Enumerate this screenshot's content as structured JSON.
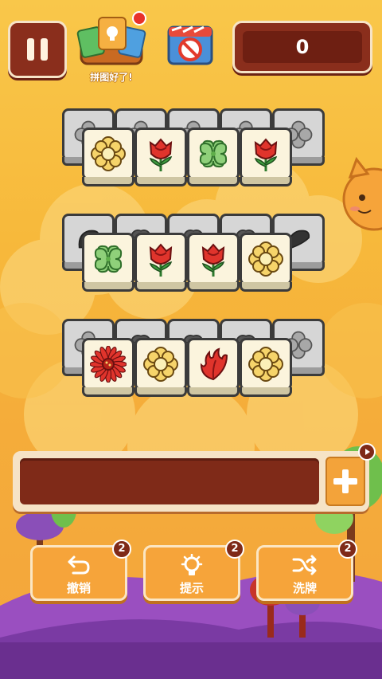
{
  "top_bar": {
    "solved_caption": "拼图好了!",
    "score": "0"
  },
  "board": {
    "rows": [
      {
        "back_icons": [
          "clover",
          "clover",
          "clover",
          "clover",
          "clover"
        ],
        "front_icons": [
          "yellow-flower-icon",
          "rose-icon",
          "clover-icon",
          "rose-icon"
        ]
      },
      {
        "back_icons": [
          "leaf",
          "bush",
          "bush",
          "bush",
          "leaf"
        ],
        "front_icons": [
          "clover-icon",
          "rose-icon",
          "rose-icon",
          "yellow-flower-icon"
        ]
      },
      {
        "back_icons": [
          "clover",
          "bush",
          "bush",
          "bush",
          "clover"
        ],
        "front_icons": [
          "red-daisy-icon",
          "yellow-flower-icon",
          "red-leaf-icon",
          "yellow-flower-icon"
        ]
      }
    ]
  },
  "tools": [
    {
      "label": "撤销",
      "count": "2",
      "icon": "undo-icon"
    },
    {
      "label": "提示",
      "count": "2",
      "icon": "lightbulb-icon"
    },
    {
      "label": "洗牌",
      "count": "2",
      "icon": "shuffle-icon"
    }
  ],
  "colors": {
    "background": "#f7b93b",
    "panel_dark": "#8a2e1c",
    "button_orange": "#f6a43a",
    "tile_face": "#fbf4dd",
    "tile_back": "#d6d6d6"
  }
}
